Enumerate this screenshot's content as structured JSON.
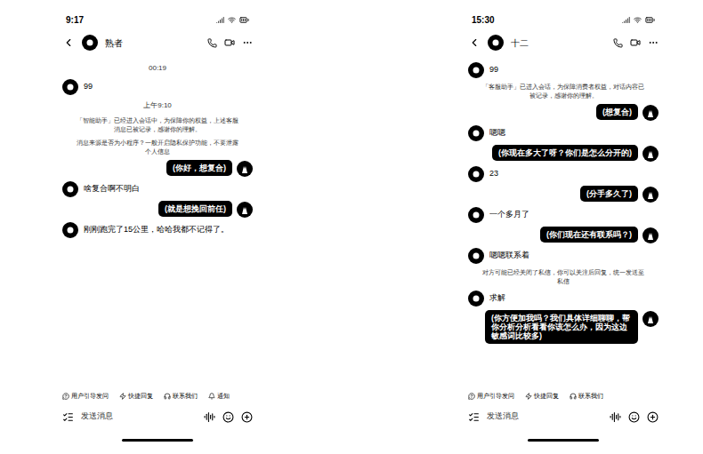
{
  "phones": [
    {
      "status_time": "9:17",
      "contact": "熟者",
      "messages": [
        {
          "kind": "time",
          "side": "center",
          "text": "00:19"
        },
        {
          "kind": "text",
          "side": "left",
          "text": "99"
        },
        {
          "kind": "time",
          "side": "center",
          "text": "上午9:10"
        },
        {
          "kind": "system",
          "side": "center",
          "text": "「智能助手」已经进入会话中，为保障你的权益，上述客服消息已被记录，感谢你的理解。"
        },
        {
          "kind": "system",
          "side": "center",
          "text": "消息来源是否为小程序？一般开启隐私保护功能，不要泄露个人信息"
        },
        {
          "kind": "text",
          "side": "right",
          "text": "(你好，想复合)"
        },
        {
          "kind": "text",
          "side": "left",
          "text": "啥复合啊不明白"
        },
        {
          "kind": "text",
          "side": "right",
          "text": "(就是想挽回前任)"
        },
        {
          "kind": "text",
          "side": "left",
          "text": "刚刚跑完了15公里，哈哈我都不记得了。"
        }
      ],
      "quick_actions": [
        "用户引导发问",
        "快捷回复",
        "联系我们",
        "通知"
      ],
      "input_placeholder": "发送消息"
    },
    {
      "status_time": "15:30",
      "contact": "十二",
      "messages": [
        {
          "kind": "text",
          "side": "left",
          "text": "99"
        },
        {
          "kind": "system",
          "side": "center",
          "text": "「客服助手」已进入会话，为保障消费者权益，对话内容已被记录，感谢你的理解。"
        },
        {
          "kind": "text",
          "side": "right",
          "text": "(想复合)"
        },
        {
          "kind": "text",
          "side": "left",
          "text": "嗯嗯"
        },
        {
          "kind": "text",
          "side": "right",
          "text": "(你现在多大了呀？你们是怎么分开的)"
        },
        {
          "kind": "text",
          "side": "left",
          "text": "23"
        },
        {
          "kind": "text",
          "side": "right",
          "text": "(分手多久了)"
        },
        {
          "kind": "text",
          "side": "left",
          "text": "一个多月了"
        },
        {
          "kind": "text",
          "side": "right",
          "text": "(你们现在还有联系吗？)"
        },
        {
          "kind": "text",
          "side": "left",
          "text": "嗯嗯联系着"
        },
        {
          "kind": "system",
          "side": "center",
          "text": "对方可能已经关闭了私信，你可以关注后回复，统一发送至私信"
        },
        {
          "kind": "text",
          "side": "left",
          "text": "求解"
        },
        {
          "kind": "text",
          "side": "right",
          "text": "(你方便加我吗？我们具体详细聊聊，帮你分析分析看看你该怎么办，因为这边敏感词比较多)"
        }
      ],
      "quick_actions": [
        "用户引导发问",
        "快捷回复",
        "联系我们"
      ],
      "input_placeholder": "发送消息"
    }
  ]
}
